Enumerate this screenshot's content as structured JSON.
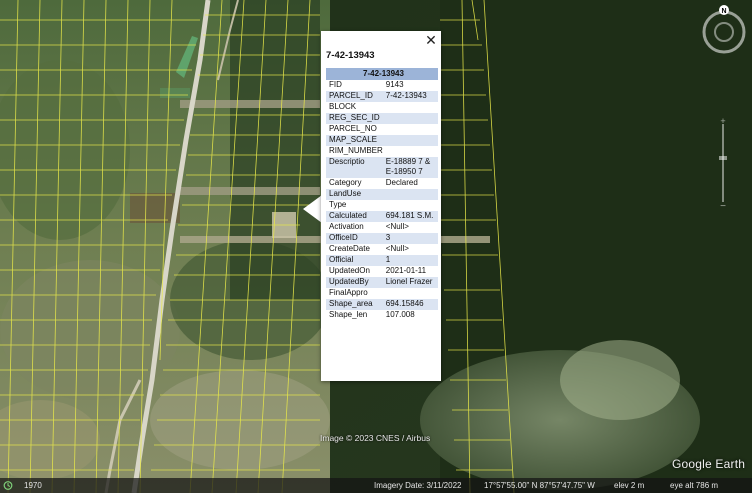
{
  "map": {
    "popup": {
      "title": "7-42-13943",
      "close_icon": "close-icon",
      "header": "7-42-13943",
      "rows": [
        {
          "key": "FID",
          "value": "9143"
        },
        {
          "key": "PARCEL_ID",
          "value": "7-42-13943"
        },
        {
          "key": "BLOCK",
          "value": ""
        },
        {
          "key": "REG_SEC_ID",
          "value": ""
        },
        {
          "key": "PARCEL_NO",
          "value": ""
        },
        {
          "key": "MAP_SCALE",
          "value": ""
        },
        {
          "key": "RIM_NUMBER",
          "value": ""
        },
        {
          "key": "Descriptio",
          "value": "E-18889 7 & E-18950 7"
        },
        {
          "key": "Category",
          "value": "Declared"
        },
        {
          "key": "LandUse",
          "value": ""
        },
        {
          "key": "Type",
          "value": ""
        },
        {
          "key": "Calculated",
          "value": "694.181 S.M."
        },
        {
          "key": "Activation",
          "value": "<Null>"
        },
        {
          "key": "OfficeID",
          "value": "3"
        },
        {
          "key": "CreateDate",
          "value": "<Null>"
        },
        {
          "key": "Official",
          "value": "1"
        },
        {
          "key": "UpdatedOn",
          "value": "2021-01-11"
        },
        {
          "key": "UpdatedBy",
          "value": "Lionel Frazer"
        },
        {
          "key": "FinalAppro",
          "value": ""
        },
        {
          "key": "Shape_area",
          "value": "694.15846"
        },
        {
          "key": "Shape_len",
          "value": "107.008"
        }
      ]
    },
    "attribution": "Image © 2023 CNES / Airbus",
    "logo": "Google Earth",
    "compass_label": "N",
    "status": {
      "history_year": "1970",
      "imagery_date": "Imagery Date: 3/11/2022",
      "coordinates": "17°57'55.00\" N   87°57'47.75\" W",
      "elev": "elev    2 m",
      "eye_alt": "eye alt    786 m"
    },
    "colors": {
      "parcel_lines": "#e8e84a",
      "popup_header": "#9cb4d8",
      "popup_alt_row": "#dbe4f2"
    }
  }
}
